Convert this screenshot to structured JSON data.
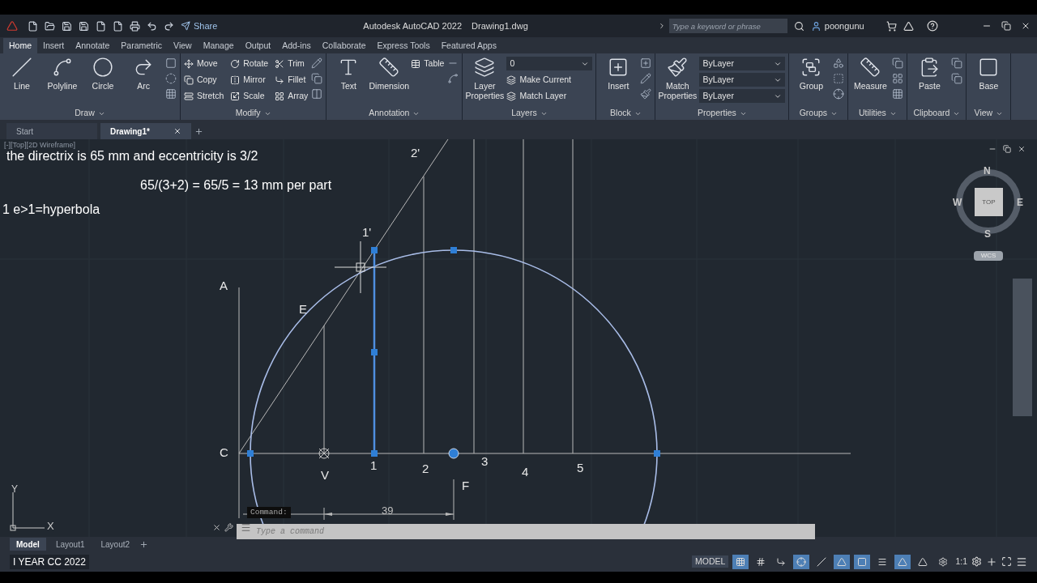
{
  "title_bar": {
    "share": "Share",
    "app_title": "Autodesk AutoCAD 2022",
    "file_name": "Drawing1.dwg",
    "search": {
      "placeholder": "Type a keyword or phrase"
    },
    "user": "poongunu"
  },
  "ribbon_tabs": [
    {
      "label": "Home",
      "selected": true
    },
    {
      "label": "Insert",
      "selected": false
    },
    {
      "label": "Annotate",
      "selected": false
    },
    {
      "label": "Parametric",
      "selected": false
    },
    {
      "label": "View",
      "selected": false
    },
    {
      "label": "Manage",
      "selected": false
    },
    {
      "label": "Output",
      "selected": false
    },
    {
      "label": "Add-ins",
      "selected": false
    },
    {
      "label": "Collaborate",
      "selected": false
    },
    {
      "label": "Express Tools",
      "selected": false
    },
    {
      "label": "Featured Apps",
      "selected": false
    }
  ],
  "ribbon_panels": [
    {
      "title": "Draw",
      "large": [
        "Line",
        "Polyline",
        "Circle",
        "Arc"
      ]
    },
    {
      "title": "Modify",
      "small": [
        "Move",
        "Copy",
        "Stretch",
        "Rotate",
        "Mirror",
        "Scale",
        "Trim",
        "Fillet",
        "Array"
      ]
    },
    {
      "title": "Annotation",
      "large": [
        "Text",
        "Dimension"
      ],
      "small": [
        "Table"
      ]
    },
    {
      "title": "Layers",
      "large": [
        "Layer Properties"
      ],
      "dropdowns": [
        "0"
      ],
      "small": [
        "Make Current",
        "Match Layer"
      ]
    },
    {
      "title": "Block",
      "large": [
        "Insert"
      ]
    },
    {
      "title": "Properties",
      "large": [
        "Match Properties"
      ],
      "dropdowns": [
        "ByLayer",
        "ByLayer",
        "ByLayer"
      ]
    },
    {
      "title": "Groups",
      "large": [
        "Group"
      ]
    },
    {
      "title": "Utilities",
      "large": [
        "Measure"
      ]
    },
    {
      "title": "Clipboard",
      "large": [
        "Paste"
      ]
    },
    {
      "title": "View",
      "large": [
        "Base"
      ]
    }
  ],
  "file_tabs": [
    {
      "label": "Start",
      "selected": false
    },
    {
      "label": "Drawing1*",
      "selected": true
    }
  ],
  "viewport": {
    "label": "[-][Top][2D Wireframe]",
    "notes": [
      "the directrix is 65 mm and eccentricity is 3/2",
      "65/(3+2) = 65/5 = 13 mm per part",
      "1 e>1=hyperbola"
    ],
    "point_labels": [
      "2'",
      "1'",
      "A",
      "E",
      "C",
      "V",
      "1",
      "2",
      "3",
      "4",
      "5",
      "F"
    ],
    "dimension": "39",
    "viewcube": {
      "north": "N",
      "east": "E",
      "south": "S",
      "west": "W",
      "face": "TOP",
      "ucs": "WCS"
    },
    "axes": {
      "x": "X",
      "y": "Y"
    }
  },
  "command_line": {
    "tooltip": "Command:",
    "placeholder": "Type a command"
  },
  "layout_tabs": [
    {
      "label": "Model",
      "selected": true
    },
    {
      "label": "Layout1",
      "selected": false
    },
    {
      "label": "Layout2",
      "selected": false
    }
  ],
  "status_bar": {
    "caption": "I YEAR CC 2022",
    "model": "MODEL",
    "scale": "1:1",
    "toggles": [
      {
        "on": true
      },
      {
        "on": false
      },
      {
        "on": false
      },
      {
        "on": true
      },
      {
        "on": false
      },
      {
        "on": true
      },
      {
        "on": true
      },
      {
        "on": false
      },
      {
        "on": true
      },
      {
        "on": false
      },
      {
        "on": false
      }
    ]
  }
}
